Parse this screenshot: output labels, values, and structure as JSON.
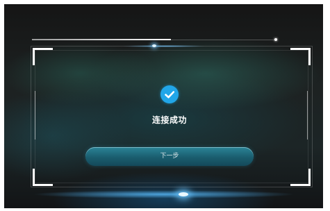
{
  "header": {
    "progress": 0.57
  },
  "status": {
    "icon": "check-circle-icon",
    "message": "连接成功",
    "icon_color": "#21a6e8"
  },
  "actions": {
    "next_label": "下一步"
  },
  "colors": {
    "background": "#1a1d1f",
    "frame": "#ffffff",
    "accent_glow": "#5abeff",
    "button": "#1f6e80"
  }
}
